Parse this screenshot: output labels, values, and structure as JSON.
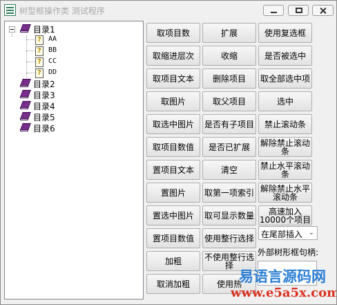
{
  "window": {
    "title": "树型框操作类 测试程序"
  },
  "tree": {
    "nodes": [
      {
        "label": "目录1",
        "expanded": true,
        "children": [
          "AA",
          "BB",
          "CC",
          "DD"
        ]
      },
      {
        "label": "目录2"
      },
      {
        "label": "目录3"
      },
      {
        "label": "目录4"
      },
      {
        "label": "目录5"
      },
      {
        "label": "目录6"
      }
    ]
  },
  "buttons": [
    [
      "取项目数",
      "扩展",
      "使用复选框"
    ],
    [
      "取缩进层次",
      "收缩",
      "是否被选中"
    ],
    [
      "取项目文本",
      "删除项目",
      "取全部选中项"
    ],
    [
      "取图片",
      "取父项目",
      "选中"
    ],
    [
      "取选中图片",
      "是否有子项目",
      "禁止滚动条"
    ],
    [
      "取项目数值",
      "是否已扩展",
      "解除禁止滚动条"
    ],
    [
      "置项目文本",
      "清空",
      "禁止水平滚动条"
    ],
    [
      "置图片",
      "取第一项索引",
      "解除禁止水平滚动条"
    ],
    [
      "置选中图片",
      "取可显示数量",
      "高速加入10000个项目"
    ],
    [
      "置项目数值",
      "使用整行选择",
      ""
    ],
    [
      "加粗",
      "不使用整行选择",
      ""
    ],
    [
      "取消加粗",
      "使用热",
      ""
    ]
  ],
  "insert_position": {
    "selected": "在尾部插入"
  },
  "external_handle": {
    "label": "外部树形框句柄:"
  },
  "watermark": {
    "text": "易语言源码网",
    "url": "www.e5a5x.com"
  },
  "colors": {
    "book": "#7a2e8c",
    "watermark_blue": "#2c7fd6",
    "watermark_red": "#d9301e"
  }
}
